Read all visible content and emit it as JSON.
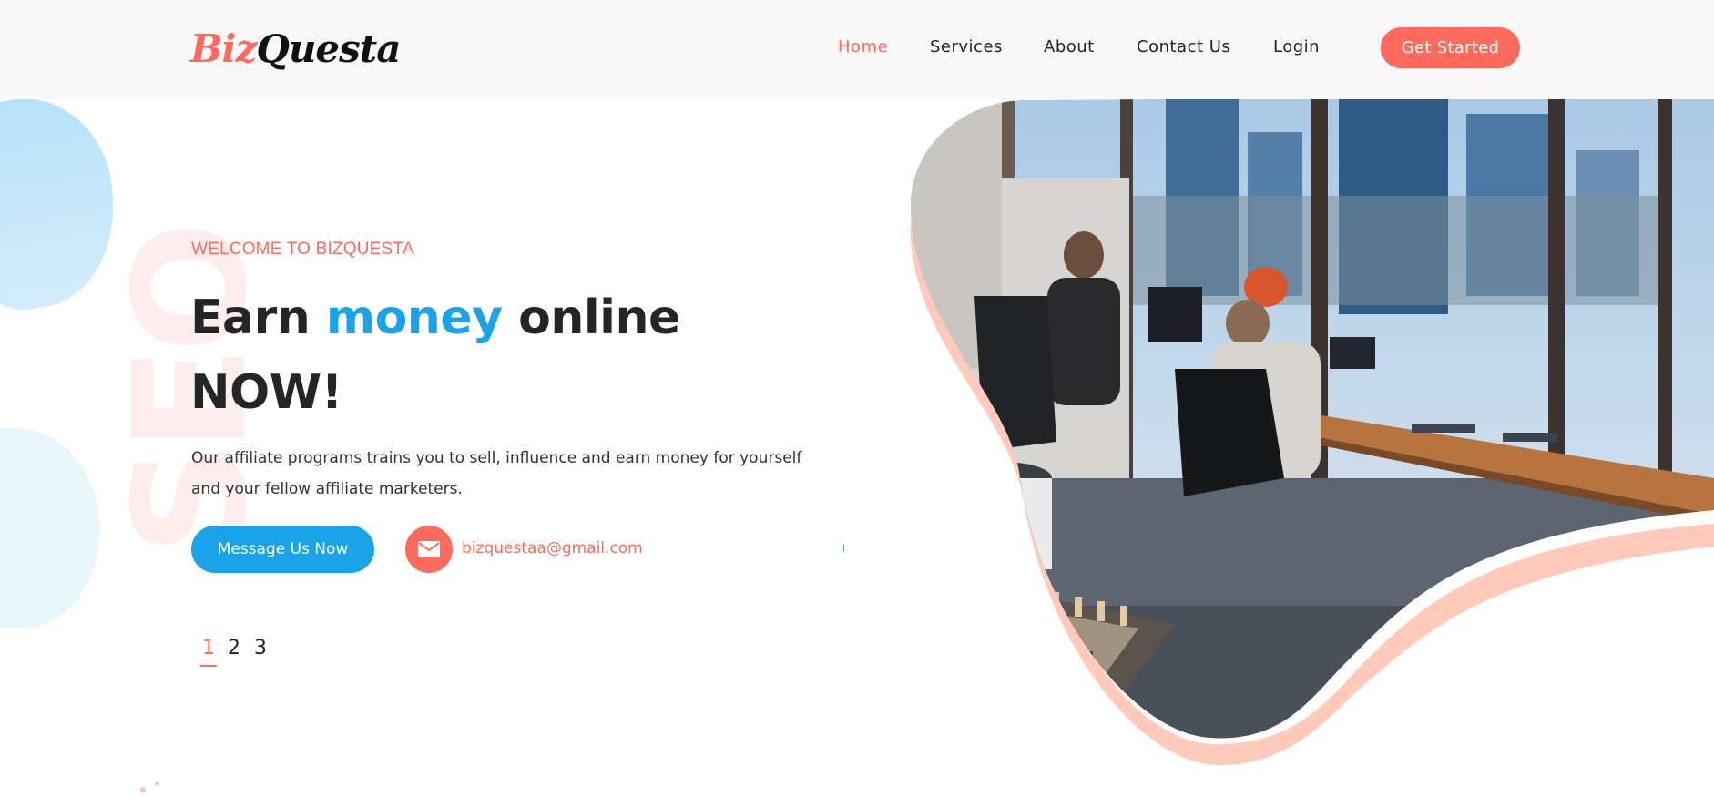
{
  "header": {
    "logo": {
      "part1": "Biz",
      "part2": "Questa"
    },
    "nav": [
      {
        "label": "Home",
        "active": true
      },
      {
        "label": "Services",
        "active": false
      },
      {
        "label": "About",
        "active": false
      },
      {
        "label": "Contact Us",
        "active": false
      },
      {
        "label": "Login",
        "active": false
      }
    ],
    "cta_label": "Get Started"
  },
  "decor": {
    "watermark": "SEO"
  },
  "hero": {
    "eyebrow": "WELCOME TO BIZQUESTA",
    "headline": {
      "pre": "Earn ",
      "highlight": "money",
      "post": " online",
      "line2": "NOW!"
    },
    "description": "Our affiliate programs trains you to sell, influence and earn money for yourself and your fellow affiliate marketers.",
    "message_button": "Message Us Now",
    "email": "bizquestaa@gmail.com",
    "slides": [
      "1",
      "2",
      "3"
    ],
    "active_slide": "1"
  },
  "colors": {
    "accent": "#ff6a5c",
    "blue": "#1aa3e8",
    "header_bg": "#f9f9f9",
    "text": "#252525"
  },
  "icons": {
    "email": "envelope-icon"
  }
}
